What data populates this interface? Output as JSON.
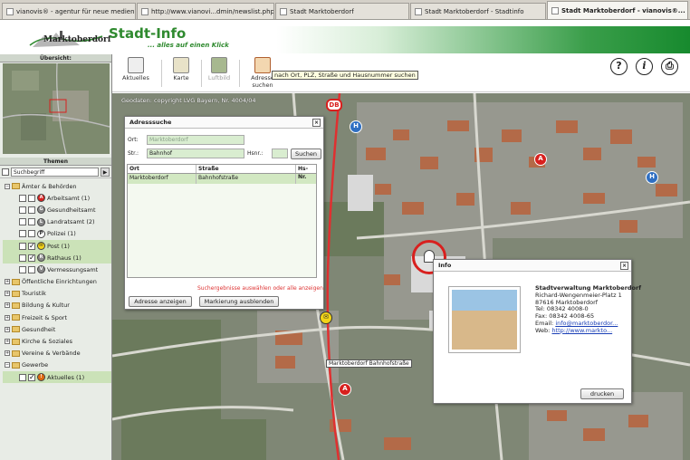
{
  "browser": {
    "tabs": [
      {
        "label": "vianovis® - agentur für neue medien",
        "active": false
      },
      {
        "label": "http://www.vianovi...dmin/newslist.php",
        "active": false
      },
      {
        "label": "Stadt Marktoberdorf",
        "active": false
      },
      {
        "label": "Stadt Marktoberdorf - Stadtinfo",
        "active": false
      },
      {
        "label": "Stadt Marktoberdorf - vianovis®...",
        "active": true
      }
    ]
  },
  "header": {
    "logo_text": "Marktoberdorf",
    "title": "Stadt-Info",
    "subtitle": "... alles auf einen Klick"
  },
  "left_panel": {
    "overview_label": "Übersicht:",
    "themes_label": "Themen",
    "search_placeholder": "Suchbegriff",
    "tree": [
      {
        "label": "Ämter & Behörden",
        "level": 0,
        "expander": "−",
        "checked": false
      },
      {
        "label": "Arbeitsamt (1)",
        "level": 1,
        "icon": "A",
        "icon_color": "#d8201e",
        "checked": false
      },
      {
        "label": "Gesundheitsamt",
        "level": 1,
        "icon": "G",
        "icon_color": "#888888",
        "checked": false
      },
      {
        "label": "Landratsamt (2)",
        "level": 1,
        "icon": "L",
        "icon_color": "#888888",
        "checked": false
      },
      {
        "label": "Polizei (1)",
        "level": 1,
        "icon": "P",
        "icon_color": "#ffffff",
        "checked": false
      },
      {
        "label": "Post (1)",
        "level": 1,
        "icon": "✉",
        "icon_color": "#f3d416",
        "checked": true,
        "highlight": true
      },
      {
        "label": "Rathaus (1)",
        "level": 1,
        "icon": "R",
        "icon_color": "#888888",
        "checked": true,
        "highlight": true
      },
      {
        "label": "Vermessungsamt",
        "level": 1,
        "icon": "V",
        "icon_color": "#888888",
        "checked": false
      },
      {
        "label": "Öffentliche Einrichtungen",
        "level": 0,
        "expander": "+",
        "checked": false
      },
      {
        "label": "Touristik",
        "level": 0,
        "expander": "+",
        "checked": false
      },
      {
        "label": "Bildung & Kultur",
        "level": 0,
        "expander": "+",
        "checked": false
      },
      {
        "label": "Freizeit & Sport",
        "level": 0,
        "expander": "+",
        "checked": false
      },
      {
        "label": "Gesundheit",
        "level": 0,
        "expander": "+",
        "checked": false
      },
      {
        "label": "Kirche & Soziales",
        "level": 0,
        "expander": "+",
        "checked": false
      },
      {
        "label": "Vereine & Verbände",
        "level": 0,
        "expander": "+",
        "checked": false
      },
      {
        "label": "Gewerbe",
        "level": 0,
        "expander": "−",
        "checked": false
      },
      {
        "label": "Aktuelles (1)",
        "level": 1,
        "icon": "!",
        "icon_color": "#e06a10",
        "checked": true,
        "highlight": true
      }
    ]
  },
  "toolbar": {
    "tools": [
      {
        "label": "Aktuelles",
        "icon": "news-icon",
        "dim": false
      },
      {
        "label": "Karte",
        "icon": "map-icon",
        "dim": false
      },
      {
        "label": "Luftbild",
        "icon": "aerial-photo-icon",
        "dim": true
      },
      {
        "label": "Adresse suchen",
        "icon": "house-search-icon",
        "dim": false
      }
    ],
    "tooltip": "nach Ort, PLZ, Straße und Hausnummer suchen",
    "help_glyph": "?",
    "info_glyph": "i",
    "print_glyph": "⎙"
  },
  "map": {
    "copyright": "Geodaten: copyright LVG Bayern, Nr. 4004/04",
    "street_label": "Marktoberdorf Bahnhofstraße",
    "db_badge": "DB"
  },
  "address_dialog": {
    "title": "Adresssuche",
    "ort_label": "Ort:",
    "ort_value": "Marktoberdorf",
    "str_label": "Str.:",
    "str_value": "Bahnhof",
    "hsnr_label": "Hsnr.:",
    "search_button": "Suchen",
    "columns": [
      "Ort",
      "Straße",
      "Hs-Nr."
    ],
    "rows": [
      [
        "Marktoberdorf",
        "Bahnhofstraße",
        ""
      ]
    ],
    "hint": "Suchergebnisse auswählen oder alle anzeigen.",
    "show_button": "Adresse anzeigen",
    "hide_button": "Markierung ausblenden"
  },
  "info_dialog": {
    "title": "Info",
    "lines": [
      {
        "text": "Stadtverwaltung Marktoberdorf",
        "style": "strong"
      },
      {
        "text": "Richard-Wengenmeier-Platz 1",
        "style": "plain"
      },
      {
        "text": "87616 Marktoberdorf",
        "style": "plain"
      },
      {
        "text": "Tel: 08342 4008-0",
        "style": "plain"
      },
      {
        "text": "Fax: 08342 4008-65",
        "style": "plain"
      }
    ],
    "email_label": "Email:",
    "email": "info@marktoberdor...",
    "web_label": "Web:",
    "web": "http://www.markto...",
    "close_button": "drucken"
  }
}
